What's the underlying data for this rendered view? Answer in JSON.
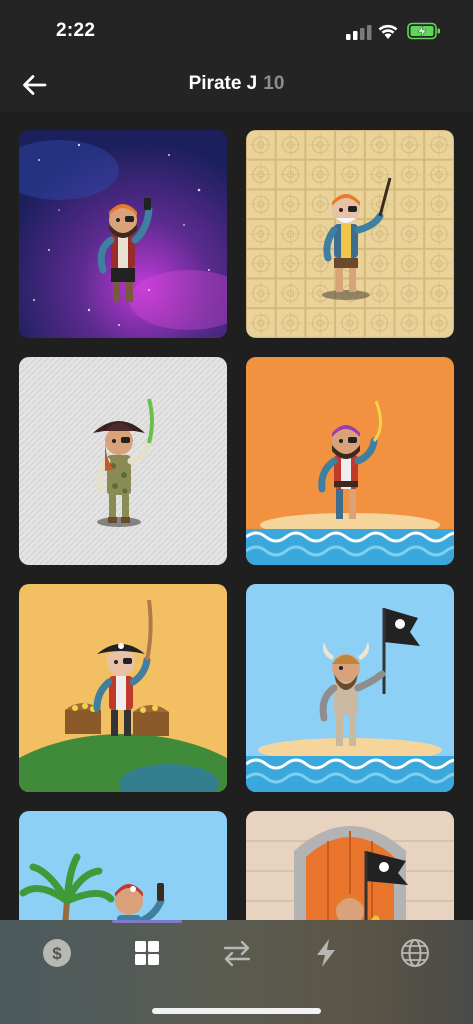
{
  "status_bar": {
    "time": "2:22",
    "icons": [
      "cellular-signal-icon",
      "wifi-icon",
      "battery-charging-icon"
    ]
  },
  "header": {
    "title": "Pirate J",
    "count": "10",
    "back_icon": "arrow-left-icon"
  },
  "grid": {
    "items": [
      {
        "background": "galaxy",
        "accent": "#5b2b8f"
      },
      {
        "background": "tan-ornamental",
        "accent": "#e5cf95"
      },
      {
        "background": "white-texture",
        "accent": "#e8e8e8"
      },
      {
        "background": "orange-island",
        "accent": "#f29241"
      },
      {
        "background": "yellow-globe",
        "accent": "#f2c063"
      },
      {
        "background": "blue-island",
        "accent": "#8dd0f5"
      },
      {
        "background": "sky-palm",
        "accent": "#8dd0f5"
      },
      {
        "background": "castle-door",
        "accent": "#e8d3c0"
      }
    ]
  },
  "tab_bar": {
    "tabs": [
      {
        "icon": "dollar-coin-icon",
        "active": false
      },
      {
        "icon": "grid-icon",
        "active": true
      },
      {
        "icon": "swap-arrows-icon",
        "active": false
      },
      {
        "icon": "lightning-icon",
        "active": false
      },
      {
        "icon": "globe-icon",
        "active": false
      }
    ]
  },
  "colors": {
    "background": "#242424",
    "title": "#ffffff",
    "count": "#8d8d8d",
    "active_tab": "#ffffff",
    "inactive_tab": "#b7b7b3",
    "tab_indicator": "#7e7ac9"
  }
}
